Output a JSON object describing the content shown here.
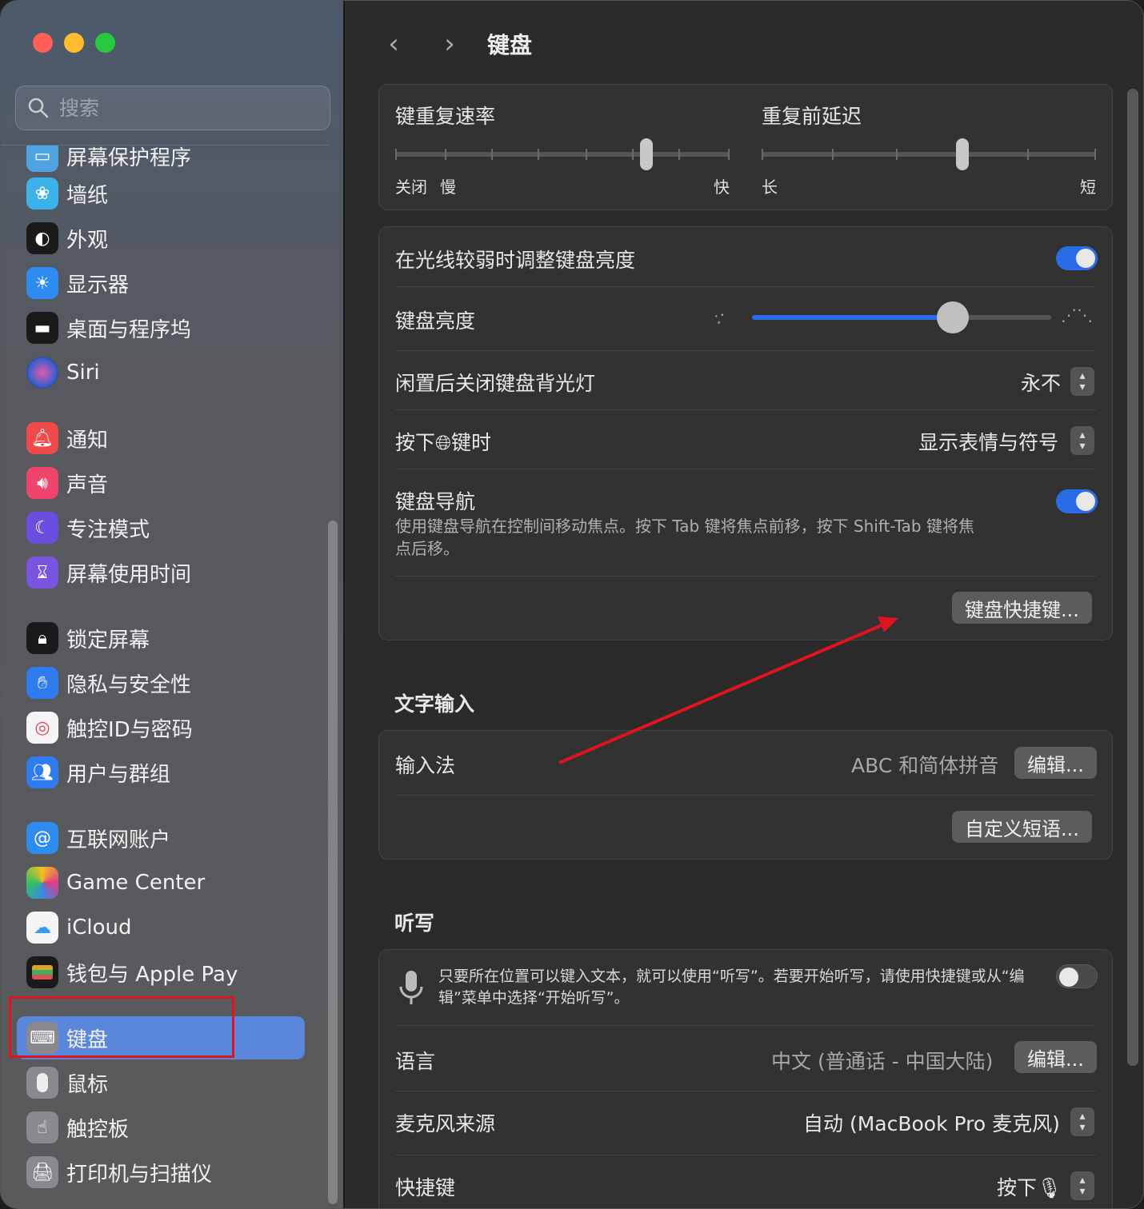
{
  "window": {
    "title": "键盘"
  },
  "search": {
    "placeholder": "搜索"
  },
  "sidebar": {
    "items": [
      {
        "label": "屏幕保护程序"
      },
      {
        "label": "墙纸"
      },
      {
        "label": "外观"
      },
      {
        "label": "显示器"
      },
      {
        "label": "桌面与程序坞"
      },
      {
        "label": "Siri"
      },
      {
        "label": "通知"
      },
      {
        "label": "声音"
      },
      {
        "label": "专注模式"
      },
      {
        "label": "屏幕使用时间"
      },
      {
        "label": "锁定屏幕"
      },
      {
        "label": "隐私与安全性"
      },
      {
        "label": "触控ID与密码"
      },
      {
        "label": "用户与群组"
      },
      {
        "label": "互联网账户"
      },
      {
        "label": "Game Center"
      },
      {
        "label": "iCloud"
      },
      {
        "label": "钱包与 Apple Pay"
      },
      {
        "label": "键盘"
      },
      {
        "label": "鼠标"
      },
      {
        "label": "触控板"
      },
      {
        "label": "打印机与扫描仪"
      }
    ],
    "selected": "键盘"
  },
  "repeat": {
    "rate_label": "键重复速率",
    "rate_off": "关闭",
    "rate_slow": "慢",
    "rate_fast": "快",
    "rate_value": 0.75,
    "delay_label": "重复前延迟",
    "delay_long": "长",
    "delay_short": "短",
    "delay_value": 0.6
  },
  "backlight": {
    "auto_label": "在光线较弱时调整键盘亮度",
    "auto_on": true,
    "brightness_label": "键盘亮度",
    "brightness_value": 0.67,
    "idle_label": "闲置后关闭键盘背光灯",
    "idle_value": "永不",
    "globe_label_pre": "按下",
    "globe_label_post": "键时",
    "globe_value": "显示表情与符号",
    "nav_label": "键盘导航",
    "nav_desc": "使用键盘导航在控制间移动焦点。按下 Tab 键将焦点前移，按下 Shift-Tab 键将焦点后移。",
    "nav_on": true,
    "shortcuts_button": "键盘快捷键..."
  },
  "text_input": {
    "heading": "文字输入",
    "input_label": "输入法",
    "input_value": "ABC 和简体拼音",
    "edit_button": "编辑...",
    "replace_button": "自定义短语..."
  },
  "dictation": {
    "heading": "听写",
    "desc": "只要所在位置可以键入文本，就可以使用“听写”。若要开始听写，请使用快捷键或从“编辑”菜单中选择“开始听写”。",
    "on": false,
    "lang_label": "语言",
    "lang_value": "中文 (普通话 - 中国大陆)",
    "lang_edit": "编辑...",
    "mic_label": "麦克风来源",
    "mic_value": "自动 (MacBook Pro 麦克风)",
    "shortcut_label": "快捷键",
    "shortcut_value": "按下"
  },
  "colors": {
    "accent": "#2a6be8",
    "selected": "#5a86dc",
    "annotation": "#e0141e"
  }
}
